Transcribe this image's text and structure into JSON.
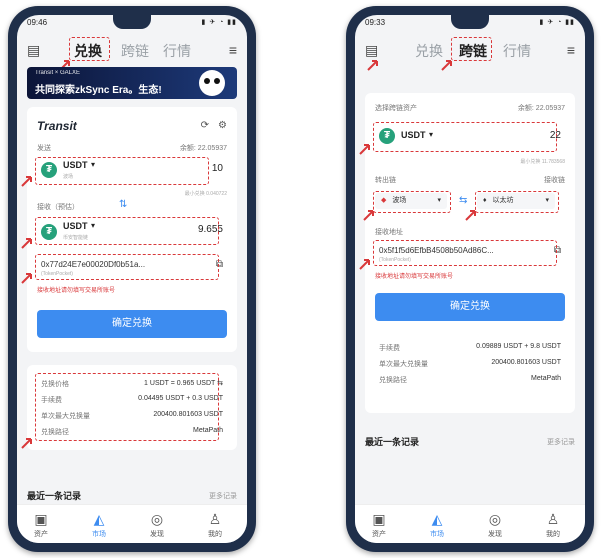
{
  "left": {
    "status": {
      "time": "09:46",
      "icons": "▮ ✈ ◔ ▮▮"
    },
    "tabs": [
      "兑换",
      "跨链",
      "行情"
    ],
    "banner": {
      "small": "Transit × GALXE",
      "title": "共同探索zkSync Era。生态!"
    },
    "card": {
      "brand": "Transit",
      "send_label": "发送",
      "balance": "余额: 22.05937",
      "from_token": "USDT",
      "from_sub": "波场",
      "from_amount": "10",
      "min_note": "最小兑换 0.040722",
      "receive_label": "接收（预估）",
      "to_token": "USDT",
      "to_sub": "币安智能链",
      "to_amount": "9.655",
      "address": "0x77d24E7e00020Df0b51a...",
      "address_sub": "(TokenPocket)",
      "error": "接收地址请勿填写交易所账号",
      "confirm": "确定兑换"
    },
    "details": [
      {
        "label": "兑换价格",
        "value": "1 USDT = 0.965 USDT ⇆"
      },
      {
        "label": "手续费",
        "value": "0.04495 USDT + 0.3 USDT"
      },
      {
        "label": "单次最大兑换量",
        "value": "200400.801603 USDT"
      },
      {
        "label": "兑换路径",
        "value": "MetaPath"
      }
    ],
    "recent": "最近一条记录",
    "more": "更多记录",
    "nav": [
      "资产",
      "市场",
      "发现",
      "我的"
    ]
  },
  "right": {
    "status": {
      "time": "09:33",
      "icons": "▮ ✈ ◔ ▮▮"
    },
    "tabs": [
      "兑换",
      "跨链",
      "行情"
    ],
    "card": {
      "select_label": "选择跨链资产",
      "balance": "余额: 22.05937",
      "token": "USDT",
      "amount": "22",
      "min_note": "最小兑换 11.783568",
      "out_chain_label": "转出链",
      "in_chain_label": "接收链",
      "out_chain": "波场",
      "in_chain": "以太坊",
      "recv_addr_label": "接收地址",
      "address": "0x5f1f5d6EfbB4508b50Ad86C...",
      "address_sub": "(TokenPocket)",
      "error": "接收地址请勿填写交易所账号",
      "confirm": "确定兑换"
    },
    "details": [
      {
        "label": "手续费",
        "value": "0.09889 USDT + 9.8 USDT"
      },
      {
        "label": "单次最大兑换量",
        "value": "200400.801603 USDT"
      },
      {
        "label": "兑换路径",
        "value": "MetaPath"
      }
    ],
    "recent": "最近一条记录",
    "more": "更多记录",
    "nav": [
      "资产",
      "市场",
      "发现",
      "我的"
    ]
  }
}
